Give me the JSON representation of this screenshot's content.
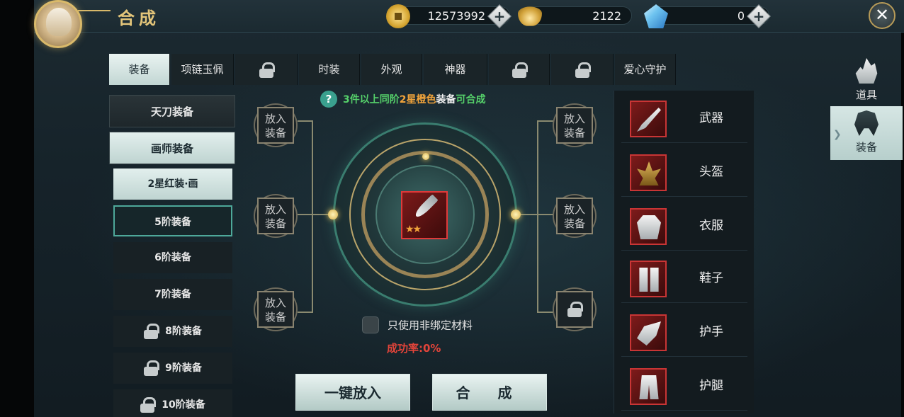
{
  "header": {
    "title": "合成",
    "currencies": [
      {
        "icon": "coin-icon",
        "amount": "12573992"
      },
      {
        "icon": "gold-ingot-icon",
        "amount": "2122"
      },
      {
        "icon": "diamond-icon",
        "amount": "0"
      }
    ],
    "close_icon": "close-icon"
  },
  "side_tabs": [
    {
      "label": "道具",
      "icon": "flame-icon"
    },
    {
      "label": "装备",
      "icon": "helmet-icon",
      "active": true
    }
  ],
  "category_tabs": [
    {
      "label": "装备",
      "active": true
    },
    {
      "label": "项链玉佩"
    },
    {
      "label": "",
      "locked": true
    },
    {
      "label": "时装"
    },
    {
      "label": "外观"
    },
    {
      "label": "神器"
    },
    {
      "label": "",
      "locked": true
    },
    {
      "label": "",
      "locked": true
    },
    {
      "label": "爱心守护"
    }
  ],
  "left_list": [
    {
      "label": "天刀装备",
      "type": "head"
    },
    {
      "label": "画师装备",
      "type": "head",
      "active": true
    },
    {
      "label": "2星红装·画",
      "type": "sub",
      "active": true
    },
    {
      "label": "5阶装备",
      "type": "sub",
      "selected": true
    },
    {
      "label": "6阶装备",
      "type": "sub"
    },
    {
      "label": "7阶装备",
      "type": "sub"
    },
    {
      "label": "8阶装备",
      "type": "sub",
      "locked": true
    },
    {
      "label": "9阶装备",
      "type": "sub",
      "locked": true
    },
    {
      "label": "10阶装备",
      "type": "sub",
      "locked": true
    }
  ],
  "craft": {
    "hint_count": "3件以上同阶",
    "hint_quality": "2星橙色",
    "hint_equip": "装备",
    "hint_result": "可合成",
    "slot_label_1": "放入",
    "slot_label_2": "装备",
    "checkbox_label": "只使用非绑定材料",
    "success_rate": "成功率:0%",
    "auto_fill_button": "一键放入",
    "craft_button": "合 成"
  },
  "equipment_list": [
    {
      "name": "武器",
      "icon": "weapon-icon"
    },
    {
      "name": "头盔",
      "icon": "helmet-icon"
    },
    {
      "name": "衣服",
      "icon": "clothes-icon"
    },
    {
      "name": "鞋子",
      "icon": "shoes-icon"
    },
    {
      "name": "护手",
      "icon": "gloves-icon"
    },
    {
      "name": "护腿",
      "icon": "leg-guard-icon"
    }
  ],
  "colors": {
    "hint_green": "#55d06a",
    "hint_orange": "#f0a33b",
    "rate_red": "#e2443a",
    "item_red": "#c93535"
  }
}
